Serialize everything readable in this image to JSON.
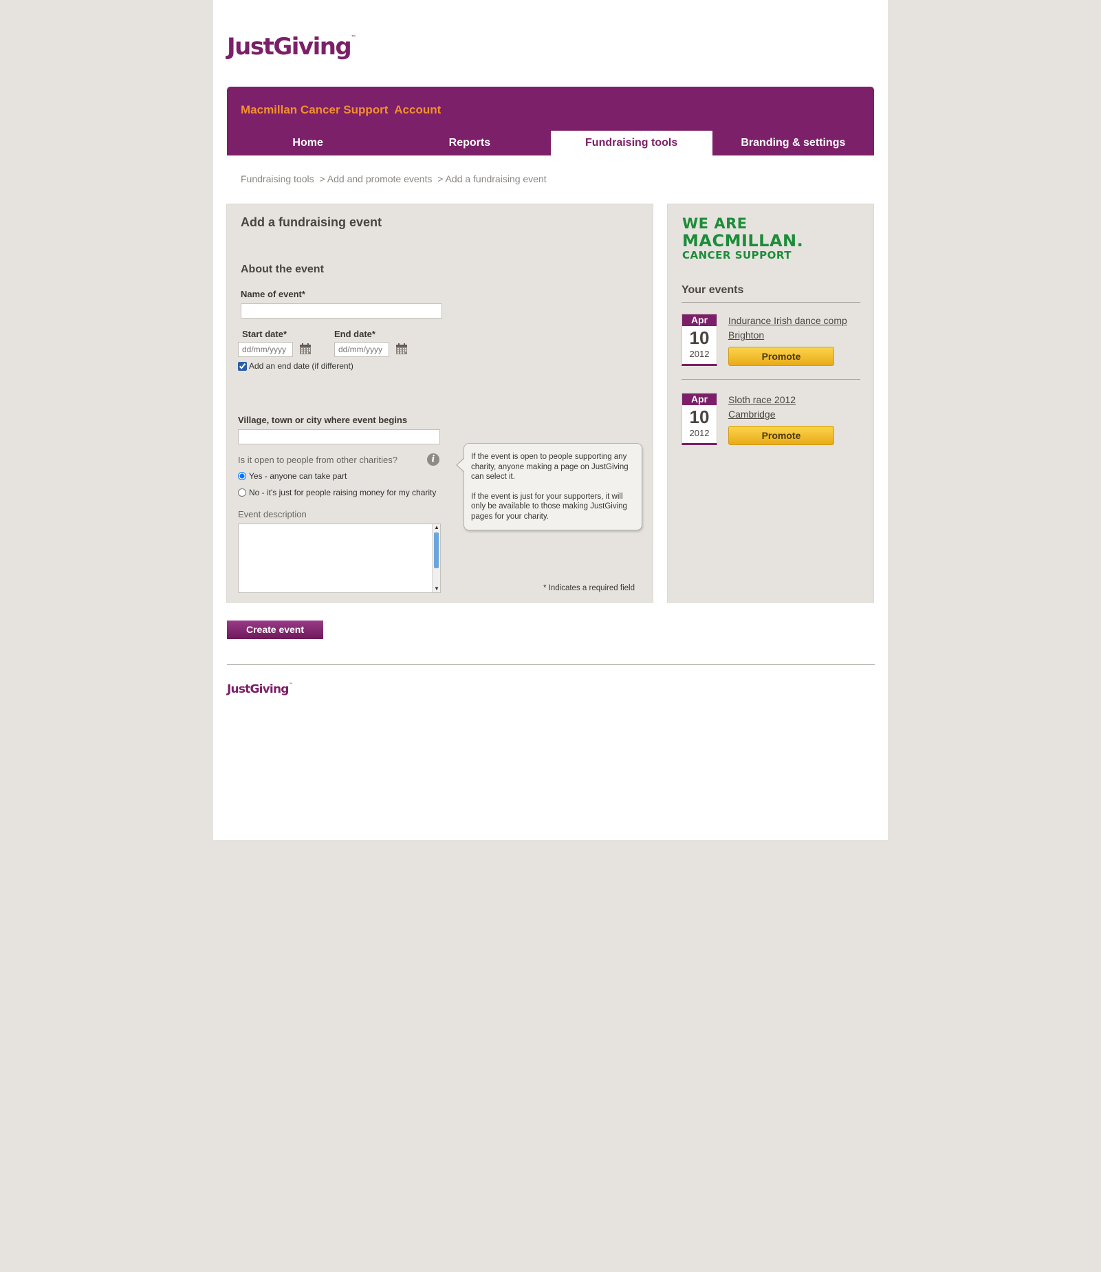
{
  "brand": {
    "name": "JustGiving",
    "tm": "™"
  },
  "header": {
    "charity": "Macmillan Cancer Support",
    "account_label": "Account"
  },
  "nav": {
    "tabs": [
      {
        "label": "Home",
        "active": false
      },
      {
        "label": "Reports",
        "active": false
      },
      {
        "label": "Fundraising tools",
        "active": true
      },
      {
        "label": "Branding & settings",
        "active": false
      }
    ]
  },
  "breadcrumb": [
    "Fundraising tools",
    "> Add and promote events",
    "> Add a fundraising event"
  ],
  "form": {
    "title": "Add a fundraising event",
    "section": "About the event",
    "name_label": "Name of event*",
    "name_value": "",
    "start_label": "Start date*",
    "start_placeholder": "dd/mm/yyyy",
    "end_label": "End date*",
    "end_placeholder": "dd/mm/yyyy",
    "end_checkbox_label": "Add an end date (if different)",
    "end_checkbox_checked": true,
    "location_label": "Village, town or city where event begins",
    "location_value": "",
    "open_question": "Is it open to people from other charities?",
    "radio_yes": "Yes - anyone can take part",
    "radio_no": "No - it's just for people raising money for my charity",
    "radio_selected": "yes",
    "description_label": "Event description",
    "description_value": "",
    "required_note": "* Indicates a required field",
    "submit_label": "Create event"
  },
  "tooltip": {
    "p1": "If the event is open to people supporting any charity, anyone making a page on JustGiving can select it.",
    "p2": "If the event is just for your supporters, it will only be available to those making JustGiving pages for your charity."
  },
  "sidebar": {
    "logo_lines": [
      "WE ARE",
      "MACMILLAN.",
      "CANCER SUPPORT"
    ],
    "events_title": "Your events",
    "events": [
      {
        "month": "Apr",
        "day": "10",
        "year": "2012",
        "name": "Indurance Irish dance comp",
        "place": "Brighton",
        "button": "Promote"
      },
      {
        "month": "Apr",
        "day": "10",
        "year": "2012",
        "name": "Sloth race 2012",
        "place": "Cambridge",
        "button": "Promote"
      }
    ]
  },
  "colors": {
    "brand_purple": "#7b2069",
    "accent_orange": "#f3902e",
    "macmillan_green": "#1d8c3a",
    "promote_yellow": "#f5c02e",
    "page_bg": "#e6e3de"
  }
}
